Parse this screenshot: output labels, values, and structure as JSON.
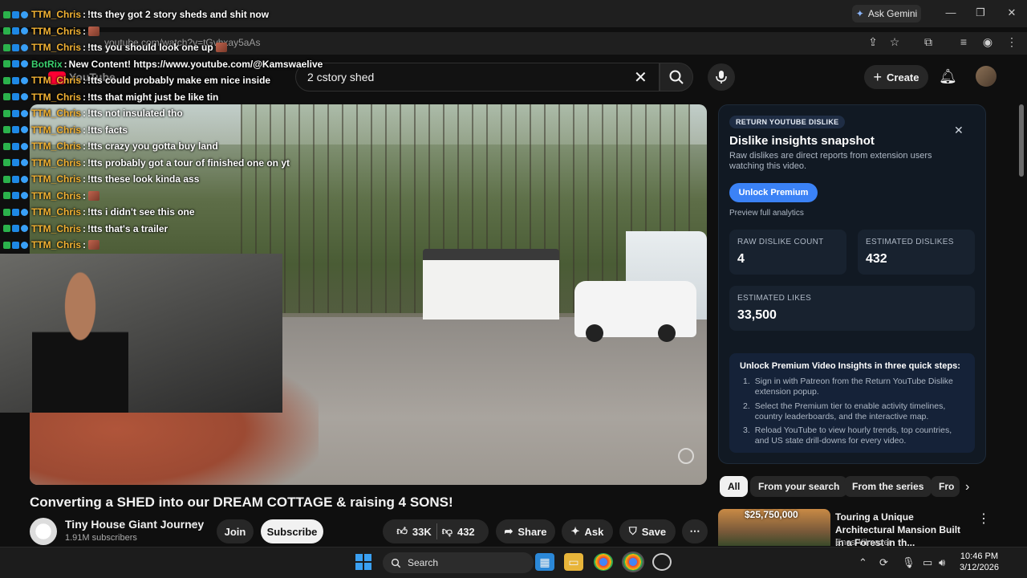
{
  "browser": {
    "gemini_label": "Ask Gemini",
    "url": "youtube.com/watch?v=tGvhxay5aAs"
  },
  "youtube": {
    "logo_text": "YouTube",
    "search_value": "2 cstory shed",
    "create_label": "Create"
  },
  "chat": [
    {
      "name": "TTM_Chris",
      "text": "!tts they got 2 story sheds and shit now",
      "emote": false,
      "bot": false
    },
    {
      "name": "TTM_Chris",
      "text": "",
      "emote": true,
      "bot": false
    },
    {
      "name": "TTM_Chris",
      "text": "!tts you should look one up",
      "emote": true,
      "bot": false
    },
    {
      "name": "BotRix",
      "text": "New Content! https://www.youtube.com/@Kamswaelive",
      "emote": false,
      "bot": true
    },
    {
      "name": "TTM_Chris",
      "text": "!tts could probably make em nice inside",
      "emote": false,
      "bot": false
    },
    {
      "name": "TTM_Chris",
      "text": "!tts that might just be like tin",
      "emote": false,
      "bot": false
    },
    {
      "name": "TTM_Chris",
      "text": "!tts not insulated tho",
      "emote": false,
      "bot": false
    },
    {
      "name": "TTM_Chris",
      "text": "!tts facts",
      "emote": false,
      "bot": false
    },
    {
      "name": "TTM_Chris",
      "text": "!tts crazy you gotta buy land",
      "emote": false,
      "bot": false
    },
    {
      "name": "TTM_Chris",
      "text": "!tts probably got a tour of finished one on yt",
      "emote": false,
      "bot": false
    },
    {
      "name": "TTM_Chris",
      "text": "!tts these look kinda ass",
      "emote": false,
      "bot": false
    },
    {
      "name": "TTM_Chris",
      "text": "",
      "emote": true,
      "bot": false
    },
    {
      "name": "TTM_Chris",
      "text": "!tts i didn't see this one",
      "emote": false,
      "bot": false
    },
    {
      "name": "TTM_Chris",
      "text": "!tts that's a trailer",
      "emote": false,
      "bot": false
    },
    {
      "name": "TTM_Chris",
      "text": "",
      "emote": true,
      "bot": false
    }
  ],
  "video": {
    "title": "Converting a SHED into our DREAM COTTAGE & raising 4 SONS!",
    "channel": "Tiny House Giant Journey",
    "subscribers": "1.91M subscribers",
    "join_label": "Join",
    "subscribe_label": "Subscribe",
    "likes": "33K",
    "dislikes": "432",
    "share_label": "Share",
    "ask_label": "Ask",
    "save_label": "Save"
  },
  "ryd": {
    "badge": "RETURN YOUTUBE DISLIKE",
    "title": "Dislike insights snapshot",
    "description": "Raw dislikes are direct reports from extension users watching this video.",
    "unlock_label": "Unlock Premium",
    "preview_label": "Preview full analytics",
    "stats": {
      "raw_label": "RAW DISLIKE COUNT",
      "raw_value": "4",
      "est_dislikes_label": "ESTIMATED DISLIKES",
      "est_dislikes_value": "432",
      "est_likes_label": "ESTIMATED LIKES",
      "est_likes_value": "33,500"
    },
    "steps_title": "Unlock Premium Video Insights in three quick steps:",
    "steps": [
      "Sign in with Patreon from the Return YouTube Dislike extension popup.",
      "Select the Premium tier to enable activity timelines, country leaderboards, and the interactive map.",
      "Reload YouTube to view hourly trends, top countries, and US state drill-downs for every video."
    ]
  },
  "chips": [
    "All",
    "From your search",
    "From the series",
    "Fro"
  ],
  "recommendation": {
    "price": "$25,750,000",
    "title": "Touring a Unique Architectural Mansion Built in a Forest in th...",
    "channel": "Enes Yilmazer"
  },
  "taskbar": {
    "search_label": "Search",
    "time": "10:46 PM",
    "date": "3/12/2026"
  }
}
